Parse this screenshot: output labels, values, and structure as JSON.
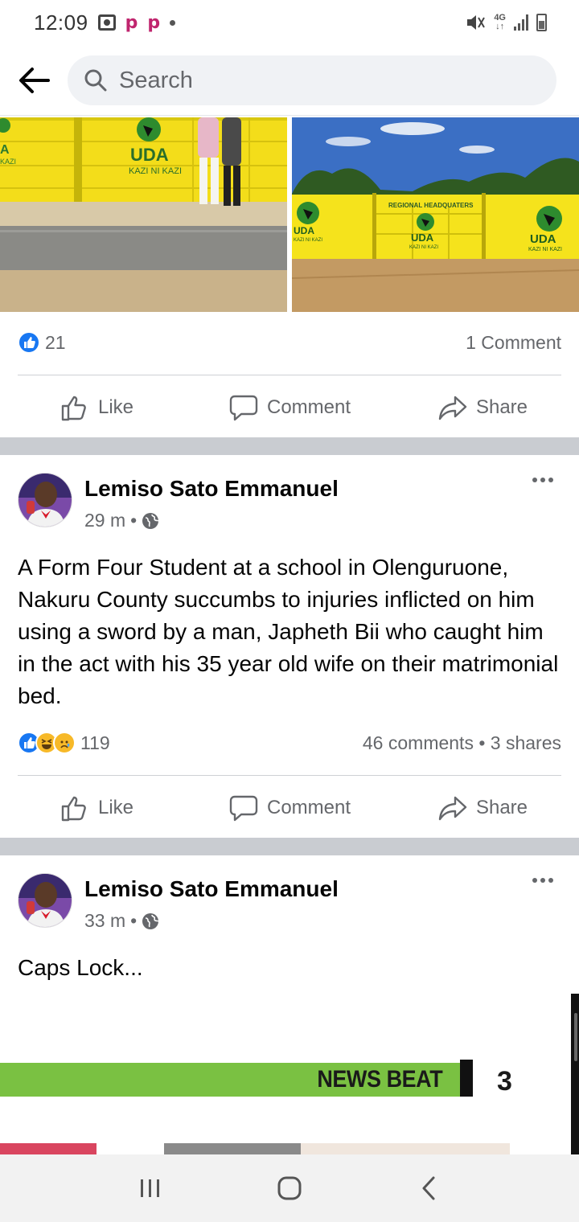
{
  "status_bar": {
    "time": "12:09",
    "network": "4G"
  },
  "header": {
    "search_placeholder": "Search"
  },
  "photo_post": {
    "photo_1": {
      "sign_text": "UDA",
      "sign_subtext": "KAZI NI KAZI",
      "left_fragment": "A",
      "left_sub": "KAZI"
    },
    "photo_2": {
      "banner_text": "REGIONAL HEADQUATERS",
      "sign_left": "UDA",
      "sign_left_sub": "KAZI NI KAZI",
      "sign_mid": "UDA",
      "sign_mid_sub": "KAZI NI KAZI",
      "sign_right": "UDA",
      "sign_right_sub": "KAZI NI KAZI"
    },
    "reaction_count": "21",
    "comment_count": "1 Comment"
  },
  "actions": {
    "like": "Like",
    "comment": "Comment",
    "share": "Share"
  },
  "posts": [
    {
      "author": "Lemiso Sato Emmanuel",
      "time": "29 m",
      "separator": "•",
      "text": "A Form Four Student at a school in Olenguruone, Nakuru County succumbs to injuries inflicted on him using a sword by a man, Japheth Bii who caught him in the act with his 35 year old wife on their matrimonial bed.",
      "reaction_count": "119",
      "engagement": "46 comments • 3 shares"
    },
    {
      "author": "Lemiso Sato Emmanuel",
      "time": "33 m",
      "separator": "•",
      "text": "Caps Lock..."
    }
  ],
  "embed": {
    "label": "NEWS BEAT",
    "number": "3"
  },
  "colors": {
    "facebook_blue": "#1877f2",
    "secondary_text": "#65676b",
    "uda_yellow": "#f5e31c",
    "uda_green": "#2e8b2e",
    "news_bar_green": "#7ac142"
  }
}
